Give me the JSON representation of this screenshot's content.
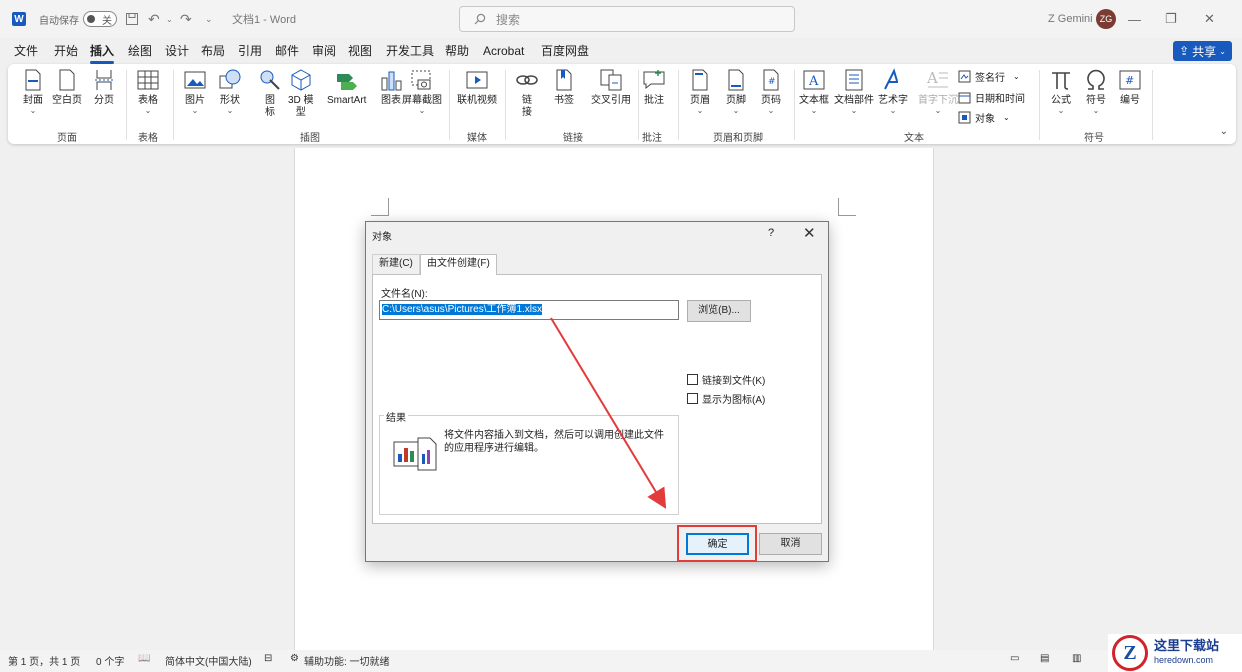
{
  "titlebar": {
    "autosave_label": "自动保存",
    "autosave_state": "关",
    "doc_title": "文档1  -  Word",
    "search_placeholder": "搜索",
    "user_name": "Z Gemini",
    "user_initials": "ZG"
  },
  "menu": {
    "tabs": [
      "文件",
      "开始",
      "插入",
      "绘图",
      "设计",
      "布局",
      "引用",
      "邮件",
      "审阅",
      "视图",
      "开发工具",
      "帮助",
      "Acrobat",
      "百度网盘"
    ],
    "active": "插入",
    "share_label": "共享"
  },
  "ribbon": {
    "groups": [
      "页面",
      "表格",
      "插图",
      "媒体",
      "链接",
      "批注",
      "页眉和页脚",
      "文本",
      "符号"
    ],
    "buttons": {
      "cover": "封面",
      "blank": "空白页",
      "break": "分页",
      "table": "表格",
      "picture": "图片",
      "shapes": "形状",
      "icons": "图\n标",
      "model3d": "3D 模\n型",
      "smartart": "SmartArt",
      "chart": "图表",
      "screenshot": "屏幕截图",
      "video": "联机视频",
      "link": "链\n接",
      "bookmark": "书签",
      "crossref": "交叉引用",
      "comment": "批注",
      "header": "页眉",
      "footer": "页脚",
      "pagenum": "页码",
      "textbox": "文本框",
      "quickparts": "文档部件",
      "wordart": "艺术字",
      "dropcap": "首字下沉",
      "signature": "签名行",
      "datetime": "日期和时间",
      "object": "对象",
      "equation": "公式",
      "symbol": "符号",
      "numbering": "编号"
    }
  },
  "dialog": {
    "title": "对象",
    "help": "?",
    "tabs": [
      "新建(C)",
      "由文件创建(F)"
    ],
    "filename_label": "文件名(N):",
    "filename_value": "C:\\Users\\asus\\Pictures\\工作簿1.xlsx",
    "browse_label": "浏览(B)...",
    "link_label": "链接到文件(K)",
    "icon_label": "显示为图标(A)",
    "result_legend": "结果",
    "result_text": "将文件内容插入到文档，然后可以调用创建此文件的应用程序进行编辑。",
    "ok_label": "确定",
    "cancel_label": "取消"
  },
  "statusbar": {
    "page": "第 1 页，共 1 页",
    "words": "0 个字",
    "language": "简体中文(中国大陆)",
    "accessibility": "辅助功能: 一切就绪"
  },
  "watermark": {
    "cn": "这里下载站",
    "en": "heredown.com",
    "logo_letter": "Z"
  },
  "colors": {
    "accent": "#185abd",
    "annotation": "#e23b3b",
    "selection": "#0078d7"
  }
}
